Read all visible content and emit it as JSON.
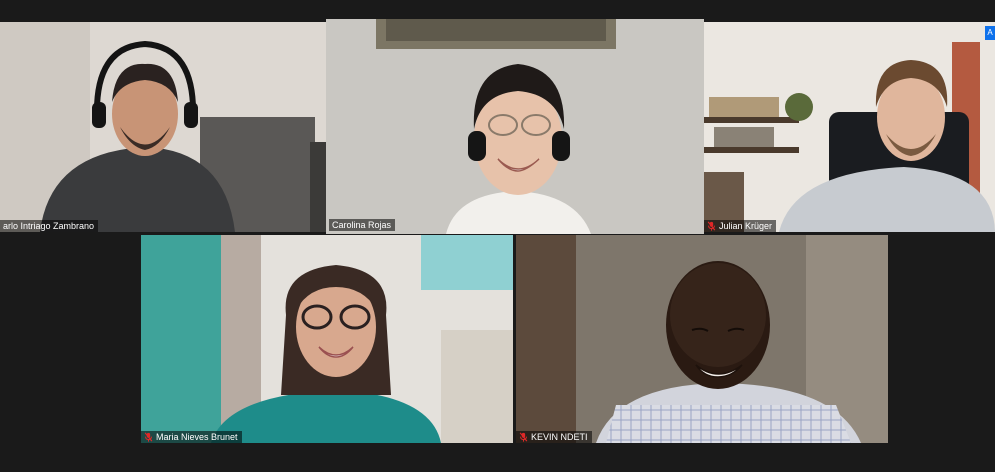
{
  "meeting": {
    "participants": [
      {
        "name": "Carlo Intriago Zambrano",
        "display": "arlo Intriago Zambrano",
        "muted": false,
        "active": false
      },
      {
        "name": "Carolina Rojas",
        "display": "Carolina Rojas",
        "muted": false,
        "active": true
      },
      {
        "name": "Julian Krüger",
        "display": "Julian Krüger",
        "muted": true,
        "active": false
      },
      {
        "name": "Maria Nieves Brunet",
        "display": "Maria Nieves Brunet",
        "muted": true,
        "active": false
      },
      {
        "name": "KEVIN NDETI",
        "display": "KEVIN NDETI",
        "muted": true,
        "active": false
      }
    ],
    "corner_badge": "A"
  },
  "colors": {
    "background": "#1a1a1a",
    "active_speaker_border": "#c8e05a",
    "muted_icon": "#e02828",
    "badge": "#0e71eb"
  }
}
